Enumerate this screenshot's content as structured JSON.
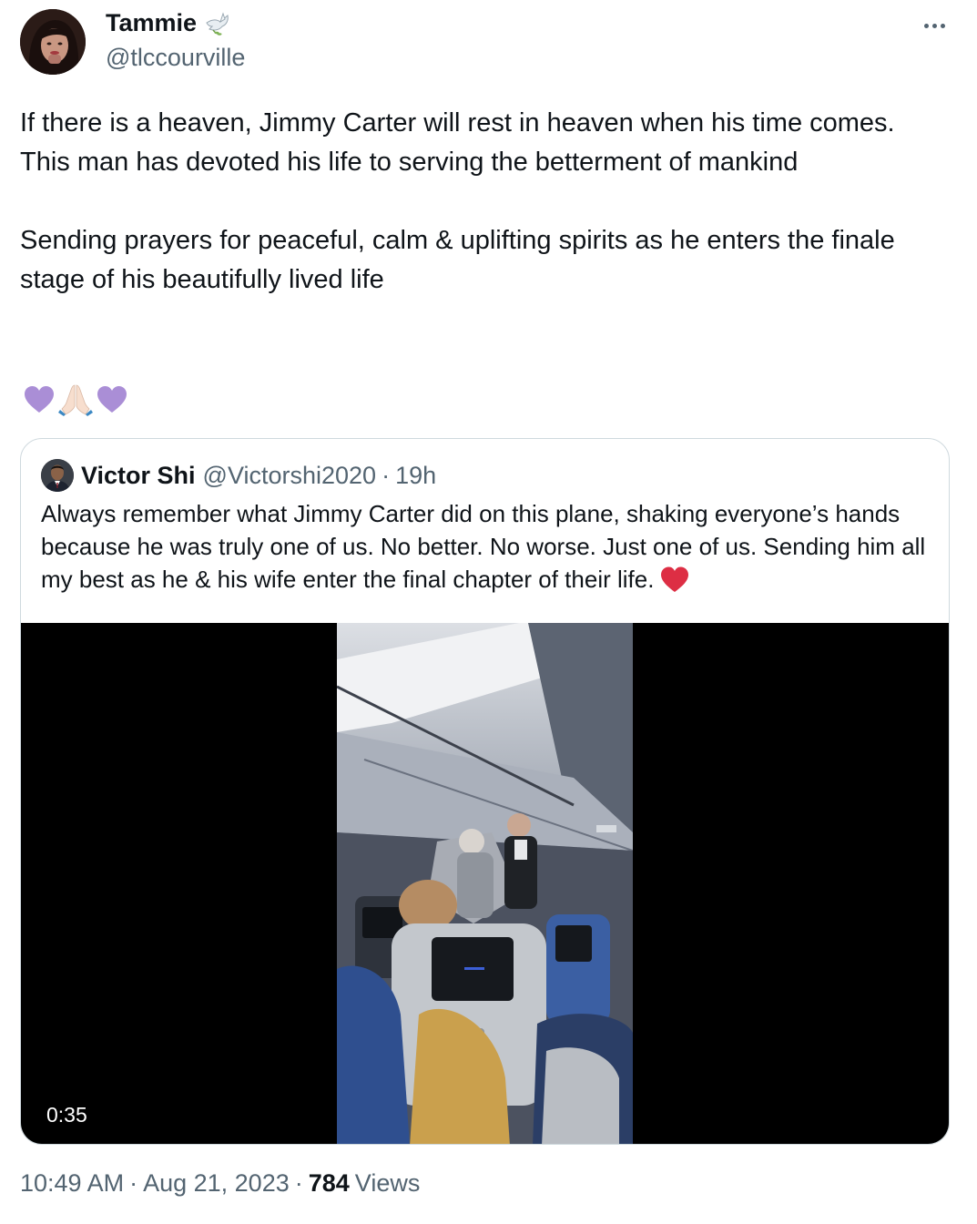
{
  "tweet": {
    "author_name": "Tammie",
    "author_handle": "@tlccourville",
    "more_label": "More",
    "paragraphs": [
      "If there is a heaven, Jimmy Carter will rest in heaven when his time comes. This man has devoted his life to serving the betterment of mankind",
      "Sending prayers for peaceful, calm & uplifting spirits as he enters the finale stage of his beautifully lived life"
    ],
    "emoji": [
      "purple-heart-icon",
      "folded-hands-icon",
      "purple-heart-icon"
    ],
    "time": "10:49 AM",
    "date": "Aug 21, 2023",
    "separator": "·",
    "views_count": "784",
    "views_label": "Views"
  },
  "quote": {
    "author_name": "Victor Shi",
    "author_handle": "@Victorshi2020",
    "separator": "·",
    "age": "19h",
    "text": "Always remember what Jimmy Carter did on this plane, shaking everyone’s hands because he was truly one of us. No better. No worse. Just one of us. Sending him all my best as he & his wife enter the final chapter of their life.",
    "video_duration": "0:35"
  },
  "colors": {
    "text_primary": "#0f1419",
    "text_secondary": "#536471",
    "border": "#cfd9de",
    "purple_heart": "#aa8ed6",
    "red_heart": "#dd2e44"
  }
}
